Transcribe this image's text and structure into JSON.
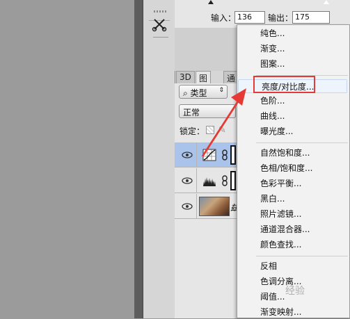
{
  "curves": {
    "input_label": "输入：",
    "input_value": "136",
    "output_label": "输出：",
    "output_value": "175"
  },
  "panel": {
    "tabs": [
      "3D",
      "图层",
      "通"
    ],
    "filter_kind": "类型",
    "blend_mode": "正常",
    "lock_label": "锁定："
  },
  "layers": [
    {
      "type": "adjustment",
      "icon": "curves-adjustment-icon",
      "selected": true
    },
    {
      "type": "adjustment",
      "icon": "levels-adjustment-icon",
      "selected": false
    },
    {
      "type": "image",
      "name_partial": "兹",
      "selected": false
    }
  ],
  "menu": {
    "items": [
      {
        "label": "纯色..."
      },
      {
        "label": "渐变..."
      },
      {
        "label": "图案..."
      },
      {
        "separator": true
      },
      {
        "label": "亮度/对比度...",
        "highlighted": true
      },
      {
        "label": "色阶..."
      },
      {
        "label": "曲线..."
      },
      {
        "label": "曝光度..."
      },
      {
        "separator": true
      },
      {
        "label": "自然饱和度..."
      },
      {
        "label": "色相/饱和度..."
      },
      {
        "label": "色彩平衡..."
      },
      {
        "label": "黑白..."
      },
      {
        "label": "照片滤镜..."
      },
      {
        "label": "通道混合器..."
      },
      {
        "label": "颜色查找..."
      },
      {
        "separator": true
      },
      {
        "label": "反相"
      },
      {
        "label": "色调分离..."
      },
      {
        "label": "阈值..."
      },
      {
        "label": "渐变映射..."
      }
    ]
  },
  "annotation": {
    "color": "#e53935"
  },
  "watermark": "经验"
}
